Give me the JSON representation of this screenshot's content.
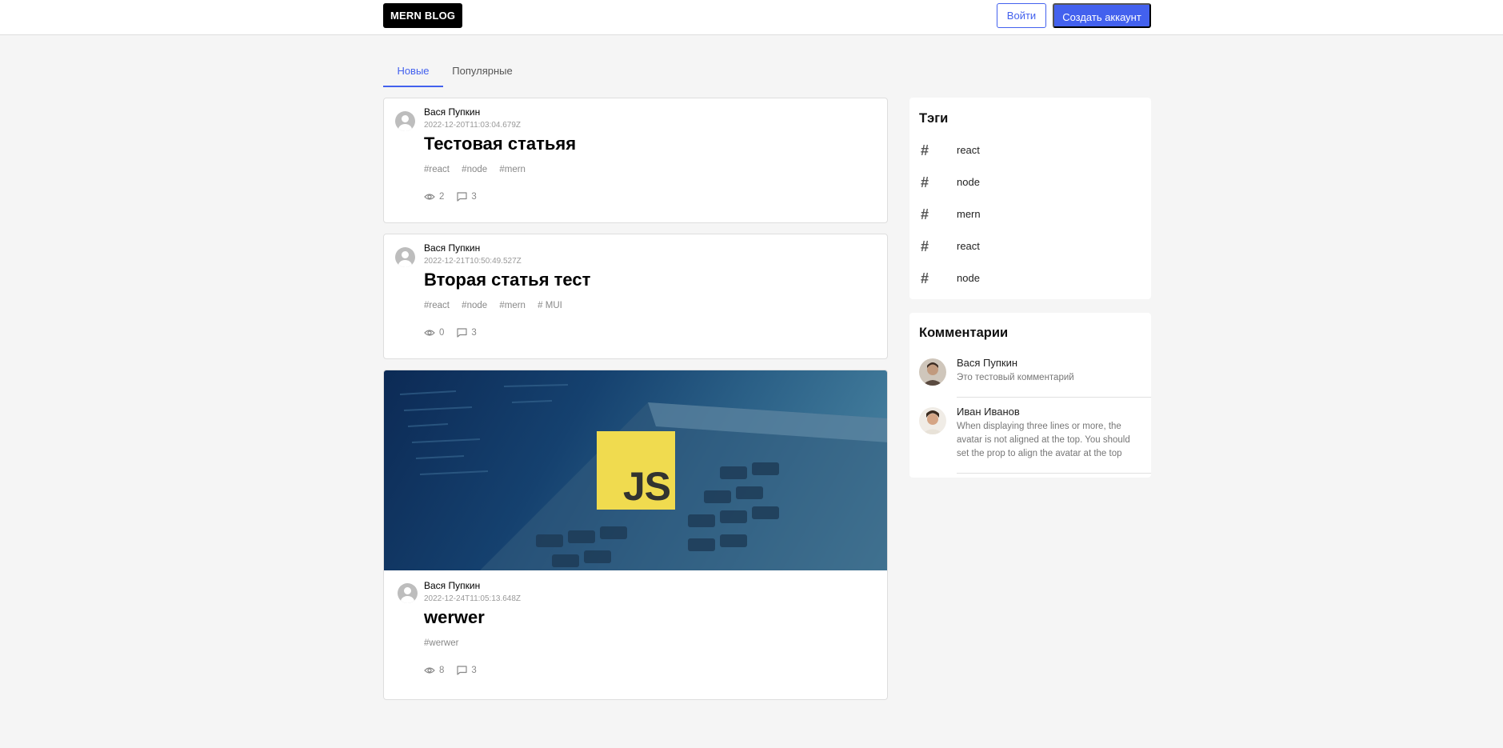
{
  "header": {
    "logo": "MERN BLOG",
    "login_label": "Войти",
    "signup_label": "Создать аккаунт"
  },
  "tabs": [
    {
      "label": "Новые",
      "active": true
    },
    {
      "label": "Популярные",
      "active": false
    }
  ],
  "posts": [
    {
      "author": "Вася Пупкин",
      "date": "2022-12-20T11:03:04.679Z",
      "title": "Тестовая статьяя",
      "tags": [
        "#react",
        "#node",
        "#mern"
      ],
      "views": "2",
      "comments": "3",
      "has_image": false
    },
    {
      "author": "Вася Пупкин",
      "date": "2022-12-21T10:50:49.527Z",
      "title": "Вторая статья тест",
      "tags": [
        "#react",
        "#node",
        "#mern",
        "# MUI"
      ],
      "views": "0",
      "comments": "3",
      "has_image": false
    },
    {
      "author": "Вася Пупкин",
      "date": "2022-12-24T11:05:13.648Z",
      "title": "werwer",
      "tags": [
        "#werwer"
      ],
      "views": "8",
      "comments": "3",
      "has_image": true,
      "image_label": "JS"
    }
  ],
  "tags_block": {
    "title": "Тэги",
    "items": [
      "react",
      "node",
      "mern",
      "react",
      "node"
    ]
  },
  "comments_block": {
    "title": "Комментарии",
    "items": [
      {
        "name": "Вася Пупкин",
        "text": "Это тестовый комментарий"
      },
      {
        "name": "Иван Иванов",
        "text": "When displaying three lines or more, the avatar is not aligned at the top. You should set the prop to align the avatar at the top"
      }
    ]
  },
  "colors": {
    "accent": "#4361ee",
    "background": "#f5f5f5",
    "js_yellow": "#f0db4f"
  }
}
